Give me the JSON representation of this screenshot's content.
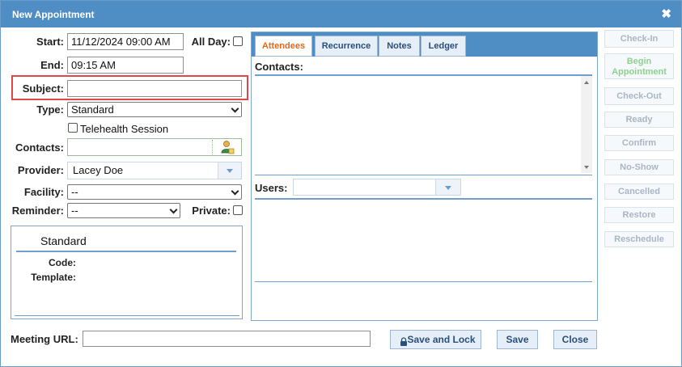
{
  "window": {
    "title": "New Appointment",
    "close_glyph": "✖"
  },
  "form": {
    "start_label": "Start:",
    "start_value": "11/12/2024 09:00 AM",
    "allday_label": "All Day:",
    "end_label": "End:",
    "end_value": "09:15 AM",
    "subject_label": "Subject:",
    "subject_value": "",
    "type_label": "Type:",
    "type_value": "Standard",
    "telehealth_label": "Telehealth Session",
    "contacts_label": "Contacts:",
    "contacts_value": "",
    "provider_label": "Provider:",
    "provider_value": "Lacey Doe",
    "facility_label": "Facility:",
    "facility_value": "--",
    "reminder_label": "Reminder:",
    "reminder_value": "--",
    "private_label": "Private:",
    "meeting_url_label": "Meeting URL:",
    "meeting_url_value": ""
  },
  "type_info": {
    "heading": "Standard",
    "code_label": "Code:",
    "code_value": "",
    "template_label": "Template:",
    "template_value": ""
  },
  "tabs": [
    {
      "label": "Attendees",
      "active": true
    },
    {
      "label": "Recurrence",
      "active": false
    },
    {
      "label": "Notes",
      "active": false
    },
    {
      "label": "Ledger",
      "active": false
    }
  ],
  "attendees": {
    "contacts_heading": "Contacts:",
    "users_label": "Users:",
    "users_value": ""
  },
  "side_actions": [
    {
      "label": "Check-In",
      "enabled": false
    },
    {
      "label": "Begin Appointment",
      "enabled": false
    },
    {
      "label": "Check-Out",
      "enabled": false
    },
    {
      "label": "Ready",
      "enabled": false
    },
    {
      "label": "Confirm",
      "enabled": false
    },
    {
      "label": "No-Show",
      "enabled": false
    },
    {
      "label": "Cancelled",
      "enabled": false
    },
    {
      "label": "Restore",
      "enabled": false
    },
    {
      "label": "Reschedule",
      "enabled": false
    }
  ],
  "footer": {
    "save_lock_label": "Save and Lock",
    "save_label": "Save",
    "close_label": "Close"
  },
  "icons": {
    "lock_icon": "lock-icon",
    "contact_picker_icon": "person-icon"
  },
  "colors": {
    "title_bar": "#4f8ec4",
    "active_tab_text": "#e06a1c",
    "highlight_border": "#e04848",
    "begin_appointment_text": "#8fd08f"
  }
}
